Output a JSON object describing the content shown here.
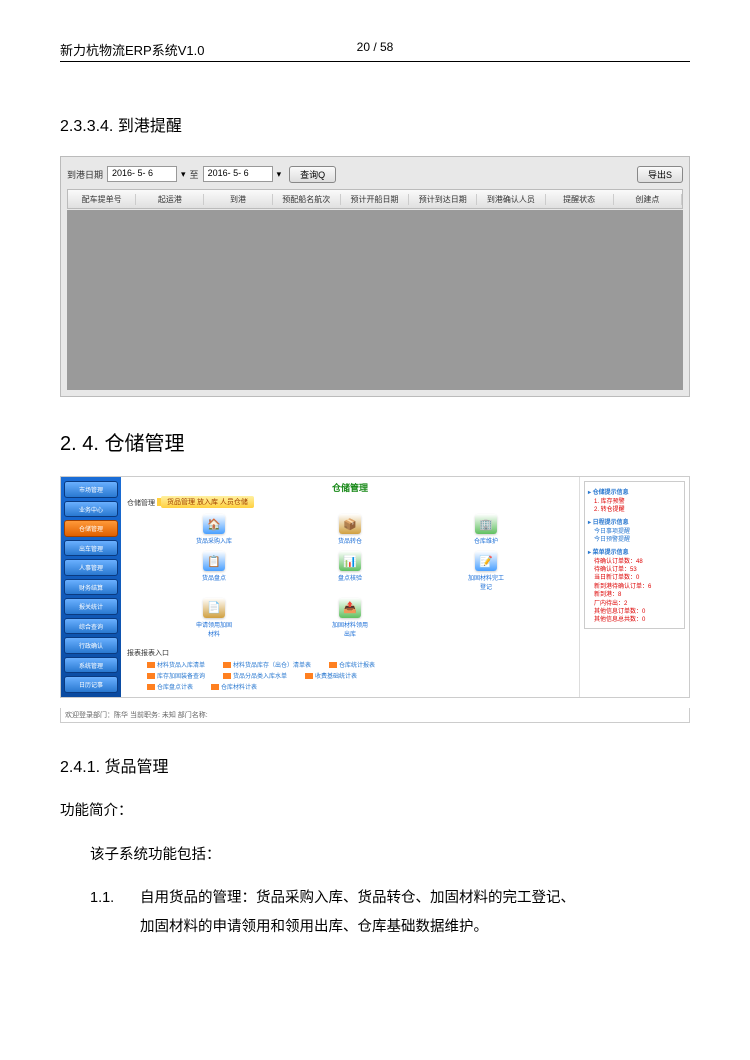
{
  "header": {
    "title": "新力杭物流ERP系统V1.0",
    "page": "20 / 58"
  },
  "sections": {
    "s2334": "2.3.3.4. 到港提醒",
    "s24": "2. 4. 仓储管理",
    "s241": "2.4.1. 货品管理"
  },
  "shot1": {
    "date_label": "到港日期",
    "date_from": "2016- 5- 6",
    "date_to_label": "至",
    "date_to": "2016- 5- 6",
    "query_btn": "查询Q",
    "export_btn": "导出S",
    "columns": [
      "配车提单号",
      "起运港",
      "到港",
      "预配船名航次",
      "预计开船日期",
      "预计到达日期",
      "到港确认人员",
      "提醒状态",
      "创建点"
    ]
  },
  "shot2": {
    "sidebar": [
      "市场管理",
      "业务中心",
      "仓储管理",
      "出车管理",
      "人事管理",
      "财务结算",
      "报关统计",
      "综合查询",
      "行政确认",
      "系统管理",
      "日历记事"
    ],
    "sidebar_active_index": 2,
    "title": "仓储管理",
    "banner_label": "仓储管理",
    "banner": "货品管理  放入库  人员仓储",
    "icons": [
      {
        "label": "货品采购入库",
        "color": "#4aa0ff",
        "glyph": "🏠"
      },
      {
        "label": "货品转仓",
        "color": "#d0a040",
        "glyph": "📦"
      },
      {
        "label": "仓库维护",
        "color": "#60c060",
        "glyph": "🏢"
      },
      {
        "label": "货品盘点",
        "color": "#4aa0ff",
        "glyph": "📋"
      },
      {
        "label": "盘点核验",
        "color": "#60c060",
        "glyph": "📊"
      },
      {
        "label": "加固材料完工登记",
        "color": "#4aa0ff",
        "glyph": "📝"
      },
      {
        "label": "申请领用加固材料",
        "color": "#d0a040",
        "glyph": "📄"
      },
      {
        "label": "加固材料领用出库",
        "color": "#60c060",
        "glyph": "📤"
      }
    ],
    "report_label": "报表报表入口",
    "reports_row1": [
      "材料货品入库清单",
      "材料货品库存（出仓）清单表",
      "仓库统计报表"
    ],
    "reports_row2": [
      "库存加固装备查询",
      "货品分品类入库水单",
      "收费基础统计表"
    ],
    "reports_row3": [
      "仓库盘点计表",
      "仓库材料计表"
    ],
    "right_panel": {
      "h1": "▸ 仓储提示信息",
      "items1": [
        "1. 库存预警",
        "2. 转仓提醒"
      ],
      "h2": "▸ 日程提示信息",
      "items2": [
        "今日事项提醒",
        "今日预警提醒"
      ],
      "h3": "▸ 菜单提示信息",
      "items3": [
        "待确认订单数：48",
        "待确认订单：53",
        "当日新订单数：0",
        "新到港待确认订单：6",
        "新到港：8",
        "厂内待出：2",
        "其他信息订单数：0",
        "其他信息总共数：0"
      ]
    },
    "status": "欢迎登录部门：陈华  当前职务: 未知  部门名称:"
  },
  "body": {
    "intro": "功能简介：",
    "line1": "该子系统功能包括：",
    "num1": "1.1.",
    "para1a": "自用货品的管理：货品采购入库、货品转仓、加固材料的完工登记、",
    "para1b": "加固材料的申请领用和领用出库、仓库基础数据维护。"
  }
}
